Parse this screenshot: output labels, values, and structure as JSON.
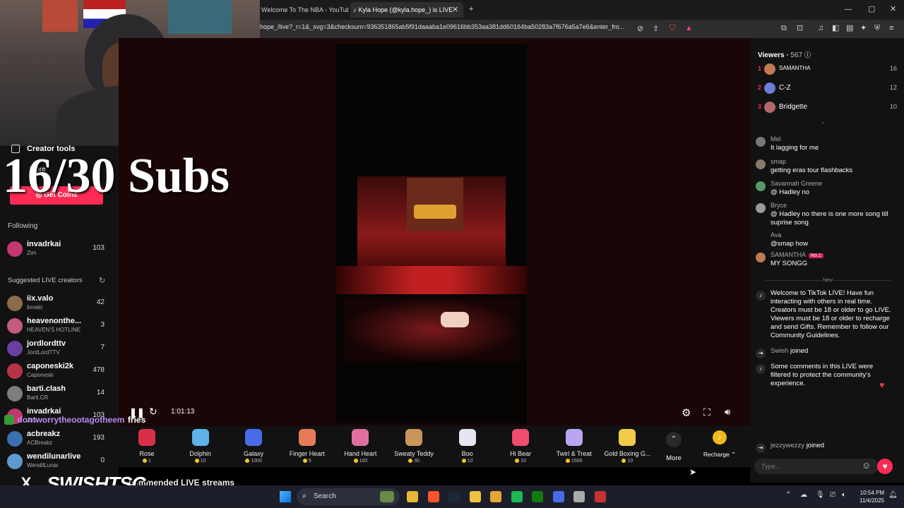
{
  "browser": {
    "tabs": [
      {
        "label": "Welcome To The NBA - YouTube",
        "active": false
      },
      {
        "label": "Kyla Hope (@kyla.hope_) is LIVE",
        "active": true
      }
    ],
    "new_tab_icon": "plus-icon",
    "url": "hope_/live?_r=1&_svg=3&checksum=936351865ab5f91daaaba1e09616bb353aa381dd60164ba50283a7f676a5a7e6&enter_fro..."
  },
  "overlay": {
    "subs_counter": "16/30 Subs",
    "streamer_watermark": "SWISHTSC",
    "chat_ticker_user": "dontworrytheootagotheem",
    "chat_ticker_text": "fries"
  },
  "sidebar": {
    "creator_tools": "Creator tools",
    "more": "More",
    "get_coins": "Get Coins",
    "following_heading": "Following",
    "following": [
      {
        "name": "invadrkai",
        "sub": "Zim",
        "count": "103",
        "avatar_color": "#c2386e"
      }
    ],
    "suggested_heading": "Suggested LIVE creators",
    "suggested": [
      {
        "name": "iix.valo",
        "sub": "iixvalo",
        "count": "42",
        "avatar_color": "#8b6b4a"
      },
      {
        "name": "heavenonthe...",
        "sub": "HEAVEN'S HOTLINE",
        "count": "3",
        "avatar_color": "#c45b7a"
      },
      {
        "name": "jordlordttv",
        "sub": "JordLordTTV",
        "count": "7",
        "avatar_color": "#6a3fa0"
      },
      {
        "name": "caponeski2k",
        "sub": "Caponeski",
        "count": "478",
        "avatar_color": "#b8324a"
      },
      {
        "name": "barti.clash",
        "sub": "Barti.CR",
        "count": "14",
        "avatar_color": "#7d7d7d"
      },
      {
        "name": "invadrkai",
        "sub": "Zim",
        "count": "103",
        "avatar_color": "#c2386e"
      },
      {
        "name": "acbreakz",
        "sub": "ACBreakz",
        "count": "193",
        "avatar_color": "#3b6fb0"
      },
      {
        "name": "wendilunarlive",
        "sub": "WendilLunar",
        "count": "0",
        "avatar_color": "#5e9ad0"
      }
    ],
    "recommended_heading": "Recommended LIVE streams",
    "recommended_fragment": "commended LIVE streams"
  },
  "player": {
    "elapsed": "1:01:13"
  },
  "gifts": [
    {
      "name": "Rose",
      "price": "1",
      "icon": "rose-icon",
      "color": "#d9304a"
    },
    {
      "name": "Dolphin",
      "price": "10",
      "icon": "dolphin-icon",
      "color": "#5fb3e8"
    },
    {
      "name": "Galaxy",
      "price": "1000",
      "icon": "galaxy-icon",
      "color": "#4a6be8"
    },
    {
      "name": "Finger Heart",
      "price": "5",
      "icon": "finger-heart-icon",
      "color": "#e87a5a"
    },
    {
      "name": "Hand Heart",
      "price": "100",
      "icon": "hand-heart-icon",
      "color": "#e06fa0"
    },
    {
      "name": "Sweaty Teddy",
      "price": "30",
      "icon": "teddy-icon",
      "color": "#c8955a"
    },
    {
      "name": "Boo",
      "price": "10",
      "icon": "ghost-icon",
      "color": "#e6e6f0"
    },
    {
      "name": "Hi Bear",
      "price": "10",
      "icon": "bear-icon",
      "color": "#ee4d6e"
    },
    {
      "name": "Twirl & Treat",
      "price": "1500",
      "icon": "twirl-icon",
      "color": "#b9a6f2"
    },
    {
      "name": "Gold Boxing G...",
      "price": "10",
      "icon": "boxing-glove-icon",
      "color": "#f2cb4a"
    }
  ],
  "gifts_more": "More",
  "recharge": "Recharge",
  "chat": {
    "viewers_label": "Viewers",
    "viewers_count": "567",
    "top_viewers": [
      {
        "rank": "1",
        "name": "SAMANTHA",
        "score": "16",
        "avatar_color": "#c07a55"
      },
      {
        "rank": "2",
        "name": "C-Z",
        "score": "12",
        "avatar_color": "#6a7fd8"
      },
      {
        "rank": "3",
        "name": "Bridgette",
        "score": "10",
        "avatar_color": "#b06a6a"
      }
    ],
    "messages": [
      {
        "user": "Mel",
        "text": "It lagging for me",
        "avatar_color": "#777"
      },
      {
        "user": "smap",
        "text": "getting eras tour flashbacks",
        "avatar_color": "#8a7a6a"
      },
      {
        "user": "Savannah Greene",
        "text": "@ Hadley no",
        "avatar_color": "#5a9a6a"
      },
      {
        "user": "Bryce",
        "text": "@ Hadley no there is one more song till suprise song",
        "avatar_color": "#9a9a9a"
      },
      {
        "user": "Ava",
        "text": "@smap how",
        "avatar_color": "#111"
      },
      {
        "user": "SAMANTHA",
        "badge": "No.1",
        "text": "MY SONGG",
        "avatar_color": "#c07a55"
      }
    ],
    "new_divider": "New",
    "system_welcome": "Welcome to TikTok LIVE! Have fun interacting with others in real time. Creators must be 18 or older to go LIVE. Viewers must be 18 or older to recharge and send Gifts. Remember to follow our Community Guidelines.",
    "join1_user": "Swish",
    "join1_text": "joined",
    "system_filter": "Some comments in this LIVE were filtered to protect the community's experience.",
    "join2_user": "jezzywezzy",
    "join2_text": "joined",
    "input_placeholder": "Type..."
  },
  "taskbar": {
    "search_label": "Search",
    "time": "10:54 PM",
    "date": "11/4/2025",
    "apps": [
      {
        "name": "file-explorer-icon",
        "color": "#e8b63a"
      },
      {
        "name": "brave-icon",
        "color": "#fb542b"
      },
      {
        "name": "steam-icon",
        "color": "#1b2838"
      },
      {
        "name": "folder-icon",
        "color": "#f0c040"
      },
      {
        "name": "stacks-icon",
        "color": "#e8a63a"
      },
      {
        "name": "spotify-icon",
        "color": "#1db954"
      },
      {
        "name": "xbox-icon",
        "color": "#107c10"
      },
      {
        "name": "app-icon",
        "color": "#4a6be8"
      },
      {
        "name": "obs-icon",
        "color": "#aaaaaa"
      },
      {
        "name": "ccleaner-icon",
        "color": "#c83232"
      }
    ]
  }
}
